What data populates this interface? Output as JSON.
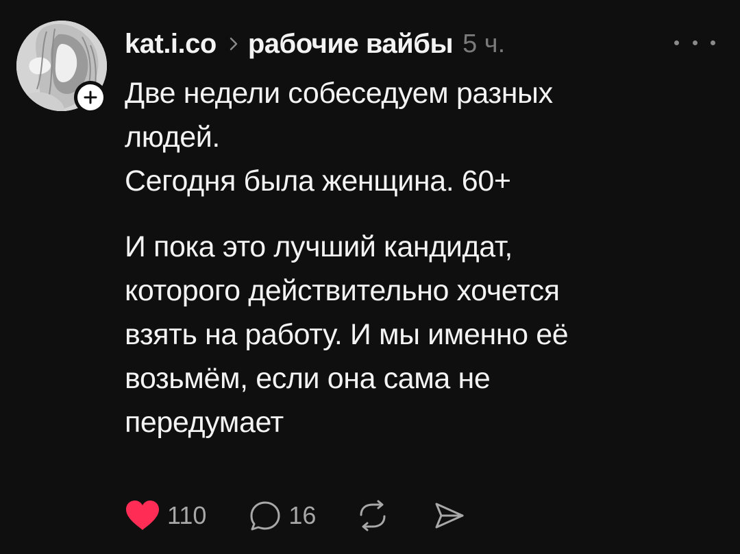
{
  "post": {
    "author": "kat.i.co",
    "community": "рабочие вайбы",
    "time": "5 ч.",
    "paragraphs": [
      "Две недели собеседуем разных\nлюдей.\nСегодня была женщина. 60+",
      "И пока это лучший кандидат,\nкоторого действительно хочется\nвзять на работу. И мы именно её\nвозьмём, если она сама не\nпередумает"
    ],
    "likes": "110",
    "replies": "16"
  },
  "icons": {
    "like": "heart-icon",
    "reply": "comment-bubble-icon",
    "repost": "repost-icon",
    "share": "send-icon",
    "more": "more-horizontal-icon",
    "follow": "plus-icon",
    "separator": "chevron-right-icon"
  },
  "colors": {
    "background": "#0f0f0f",
    "text": "#f3f3f3",
    "muted": "#7a7a7a",
    "like": "#ff2d55"
  }
}
